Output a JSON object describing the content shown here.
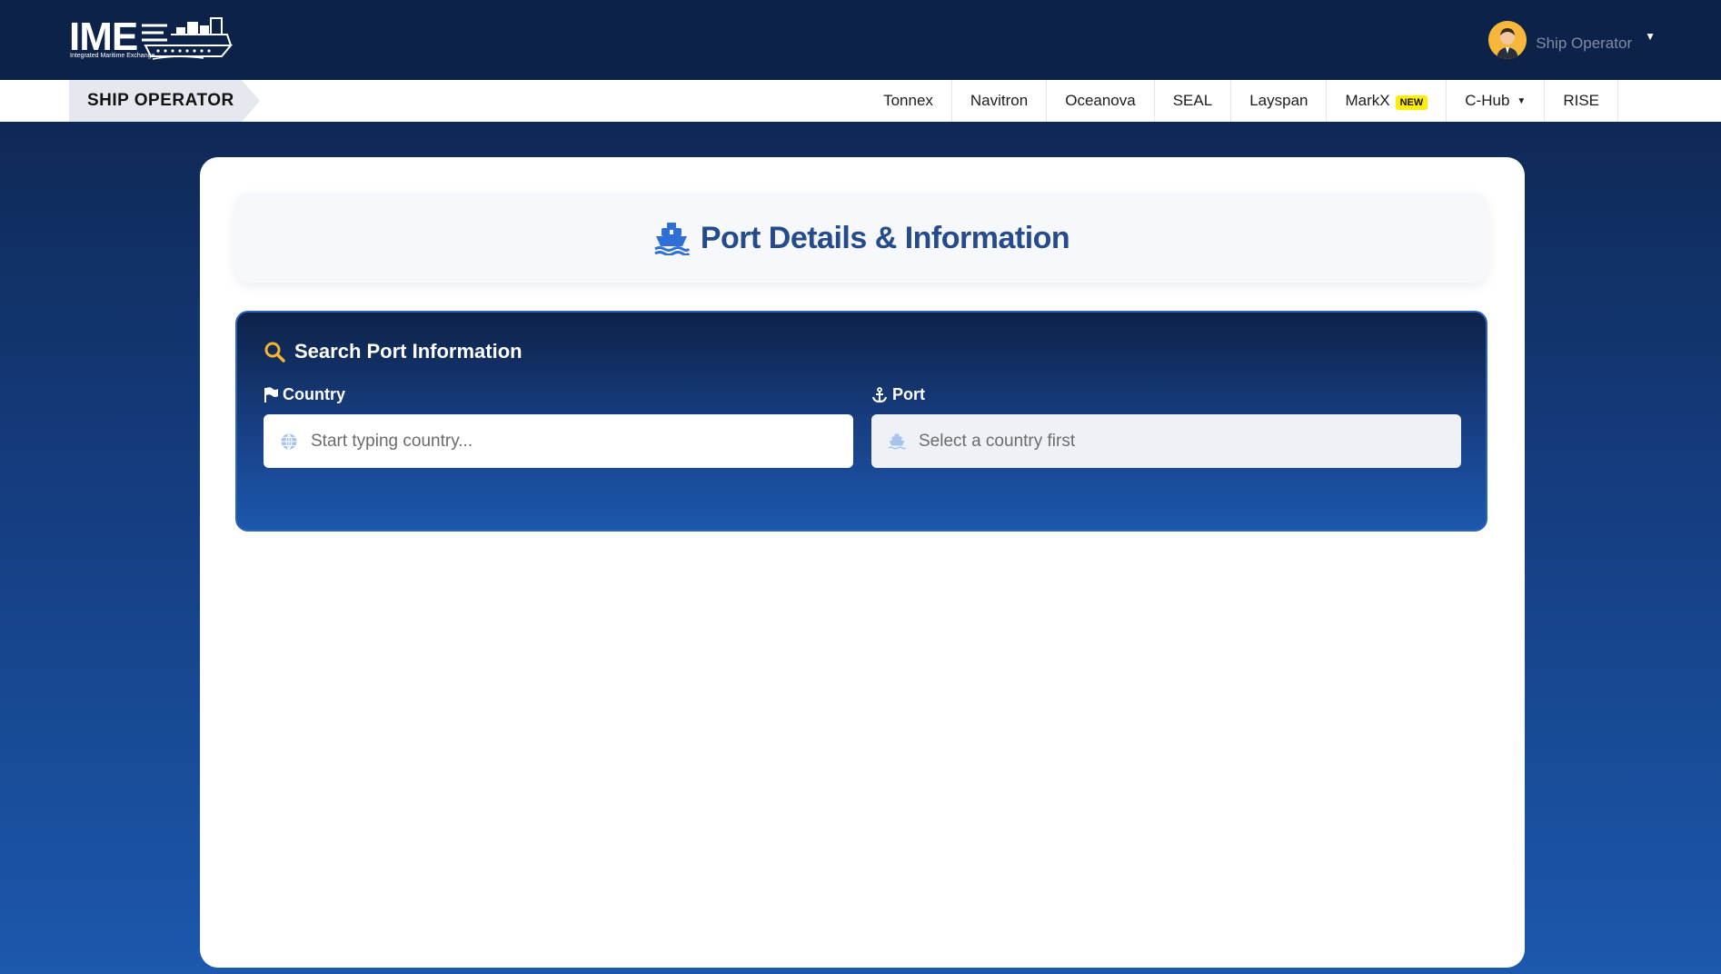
{
  "header": {
    "logo_text": "IME",
    "logo_subtitle": "Integrated Maritime Exchange",
    "user_name": "Ship Operator"
  },
  "subnav": {
    "role": "SHIP OPERATOR",
    "links": [
      {
        "label": "Tonnex"
      },
      {
        "label": "Navitron"
      },
      {
        "label": "Oceanova"
      },
      {
        "label": "SEAL"
      },
      {
        "label": "Layspan"
      },
      {
        "label": "MarkX",
        "badge": "NEW"
      },
      {
        "label": "C-Hub",
        "dropdown": true
      },
      {
        "label": "RISE"
      }
    ]
  },
  "main": {
    "title": "Port Details & Information",
    "title_icon": "ship-icon",
    "search": {
      "title": "Search Port Information",
      "country_label": "Country",
      "country_placeholder": "Start typing country...",
      "port_label": "Port",
      "port_placeholder": "Select a country first"
    }
  },
  "colors": {
    "header_bg": "#0d2248",
    "accent_blue": "#254b8c",
    "search_icon": "#f5b52e",
    "badge": "#ffee00"
  }
}
